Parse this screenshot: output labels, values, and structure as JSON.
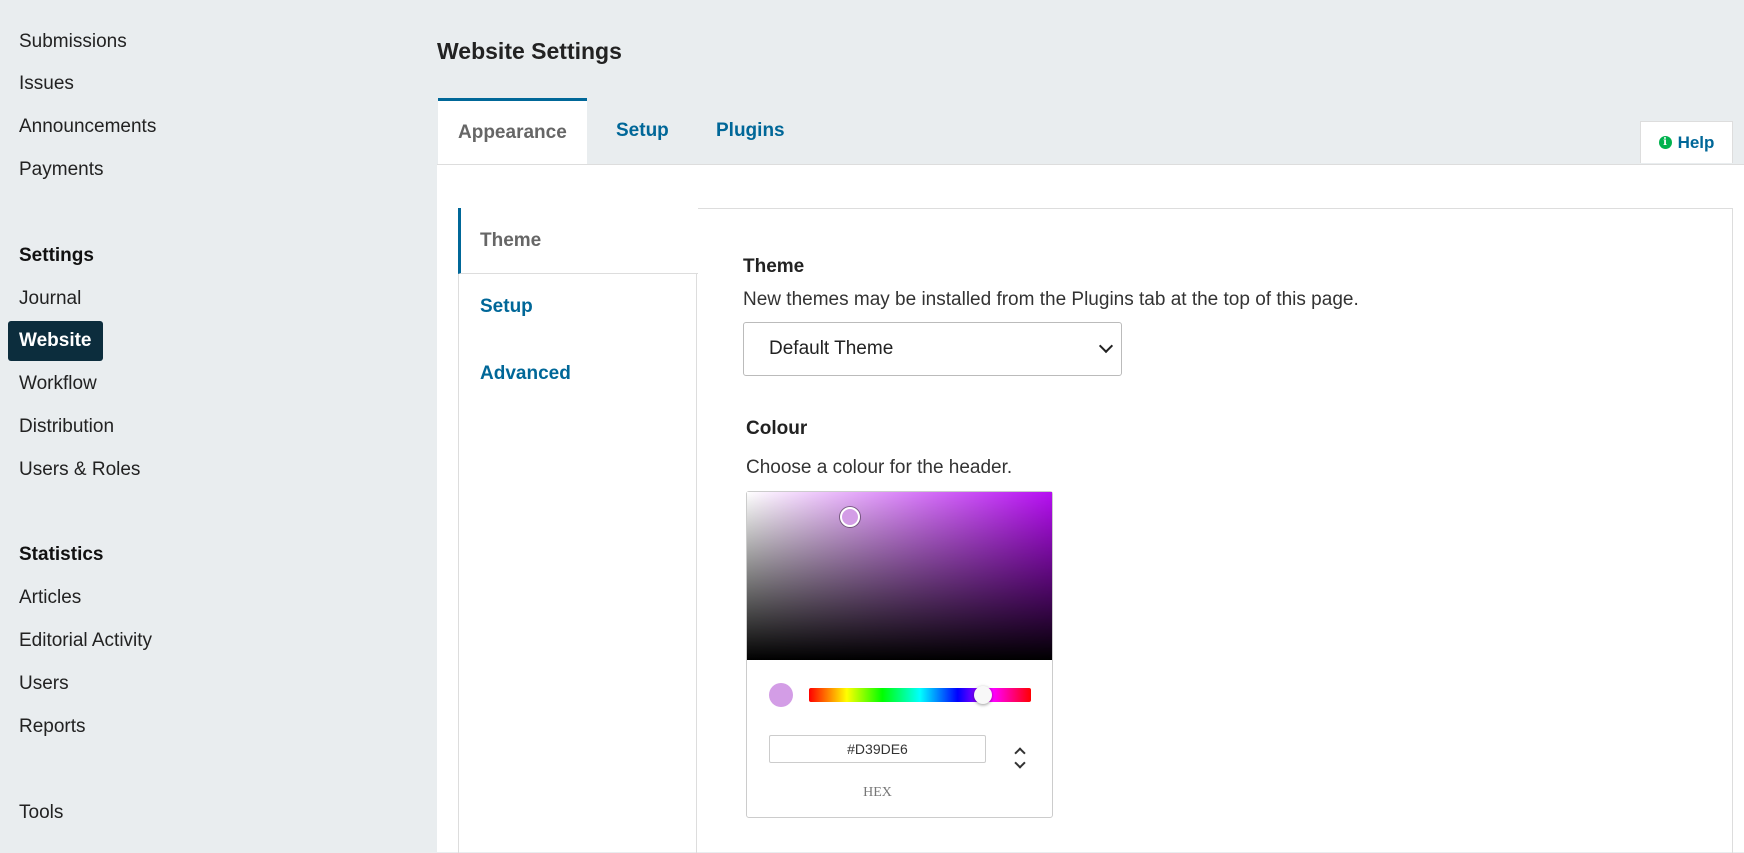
{
  "sidebar": {
    "items": [
      {
        "label": "Submissions"
      },
      {
        "label": "Issues"
      },
      {
        "label": "Announcements"
      },
      {
        "label": "Payments"
      }
    ],
    "settings_heading": "Settings",
    "settings_items": [
      {
        "label": "Journal"
      },
      {
        "label": "Website"
      },
      {
        "label": "Workflow"
      },
      {
        "label": "Distribution"
      },
      {
        "label": "Users & Roles"
      }
    ],
    "statistics_heading": "Statistics",
    "statistics_items": [
      {
        "label": "Articles"
      },
      {
        "label": "Editorial Activity"
      },
      {
        "label": "Users"
      },
      {
        "label": "Reports"
      }
    ],
    "tools_label": "Tools"
  },
  "header": {
    "title": "Website Settings",
    "tabs": [
      {
        "label": "Appearance"
      },
      {
        "label": "Setup"
      },
      {
        "label": "Plugins"
      }
    ],
    "help_label": "Help"
  },
  "subnav": {
    "tabs": [
      {
        "label": "Theme"
      },
      {
        "label": "Setup"
      },
      {
        "label": "Advanced"
      }
    ]
  },
  "theme": {
    "label": "Theme",
    "description": "New themes may be installed from the Plugins tab at the top of this page.",
    "selected": "Default Theme"
  },
  "colour": {
    "label": "Colour",
    "description": "Choose a colour for the header.",
    "hex_value": "#D39DE6",
    "format_label": "HEX",
    "hue_fraction": 0.785
  },
  "colors": {
    "accent": "#006798",
    "active_nav_bg": "#0c2d3d",
    "selected_colour": "#D39DE6",
    "hue_base": "#b60ef2"
  }
}
